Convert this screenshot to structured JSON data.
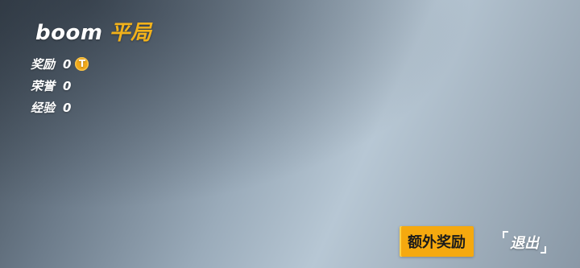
{
  "header": {
    "player_name": "boom",
    "result": "平局"
  },
  "stats": [
    {
      "label": "奖励",
      "value": "0",
      "icon": "coin-icon"
    },
    {
      "label": "荣誉",
      "value": "0"
    },
    {
      "label": "经验",
      "value": "0"
    }
  ],
  "coin_symbol": "T",
  "actions": {
    "bonus_label": "额外奖励",
    "exit_label": "退出"
  },
  "colors": {
    "accent": "#f2b21b",
    "button": "#f5a90f",
    "text": "#ffffff"
  }
}
